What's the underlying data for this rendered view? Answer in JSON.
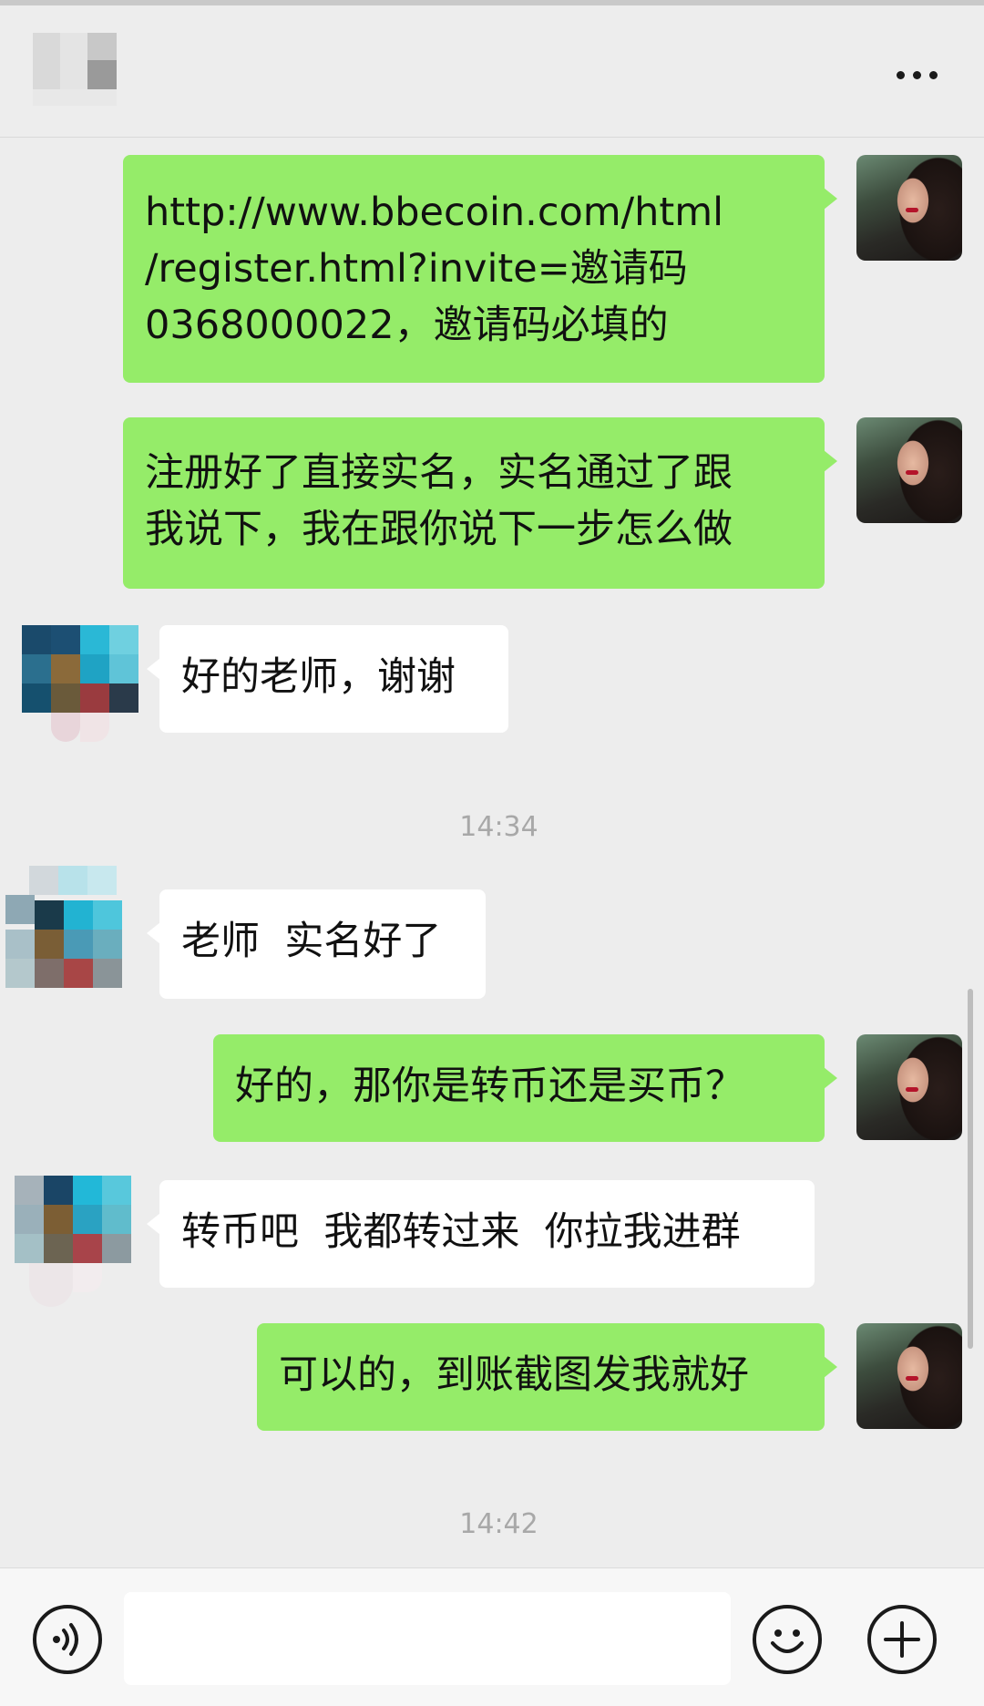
{
  "header": {
    "title_blurred": true,
    "more_icon": "more-horizontal-icon"
  },
  "messages": [
    {
      "side": "right",
      "text": "http://www.bbecoin.com/html\n/register.html?invite=邀请码\n0368000022，邀请码必填的"
    },
    {
      "side": "right",
      "text": "注册好了直接实名，实名通过了跟\n我说下，我在跟你说下一步怎么做"
    },
    {
      "side": "left",
      "text": "好的老师，谢谢"
    },
    {
      "side": "left",
      "text": "老师  实名好了"
    },
    {
      "side": "right",
      "text": "好的，那你是转币还是买币？"
    },
    {
      "side": "left",
      "text": "转币吧  我都转过来  你拉我进群"
    },
    {
      "side": "right",
      "text": "可以的，到账截图发我就好"
    }
  ],
  "timestamps": [
    "14:34",
    "14:42"
  ],
  "input_bar": {
    "voice_icon": "voice-icon",
    "input_value": "",
    "emoji_icon": "emoji-icon",
    "plus_icon": "plus-icon"
  },
  "colors": {
    "sent_bubble": "#95ec69",
    "received_bubble": "#ffffff",
    "background": "#ededed"
  }
}
